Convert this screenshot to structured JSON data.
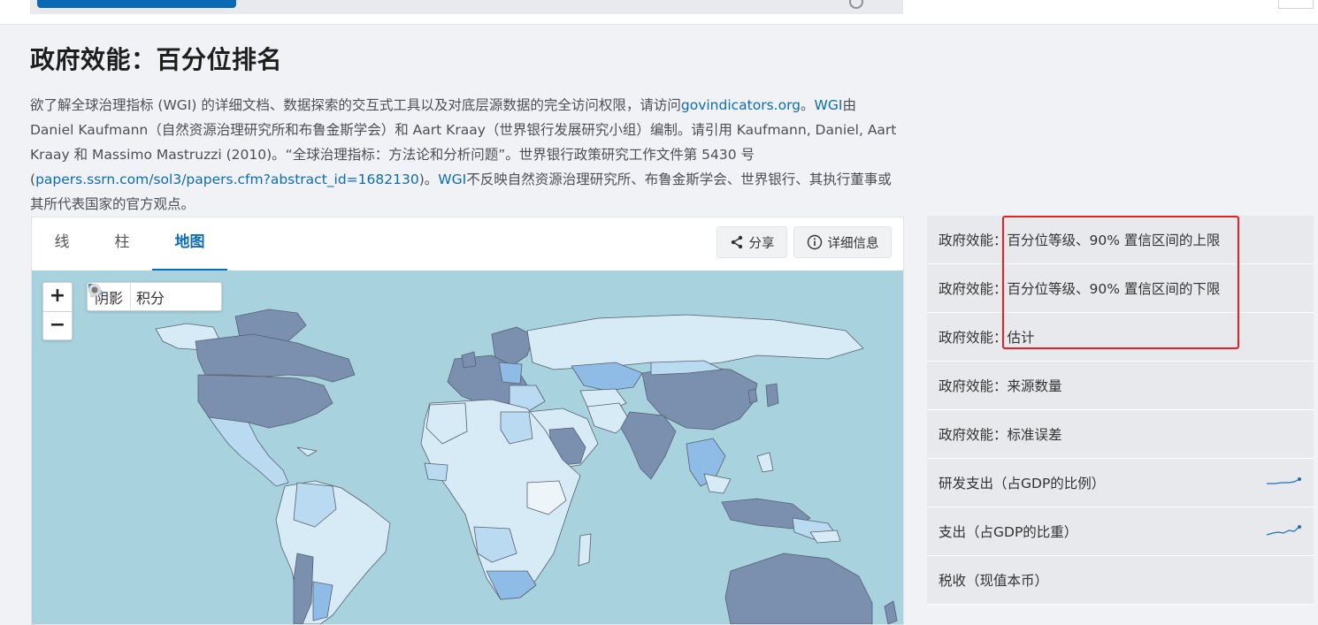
{
  "page": {
    "title": "政府效能：百分位排名",
    "description": {
      "p1": "欲了解全球治理指标 (WGI) 的详细文档、数据探索的交互式工具以及对底层源数据的完全访问权限，请访问",
      "link1": "govindicators.org",
      "p2": "。",
      "link2": "WGI",
      "p3": "由 Daniel Kaufmann（自然资源治理研究所和布鲁金斯学会）和 Aart Kraay（世界银行发展研究小组）编制。请引用 Kaufmann, Daniel, Aart Kraay 和 Massimo Mastruzzi (2010)。“全球治理指标：方法论和分析问题”。世界银行政策研究工作文件第 5430 号 (",
      "link3": "papers.ssrn.com/sol3/papers.cfm?abstract_id=1682130",
      "p4": ")。",
      "link4": "WGI",
      "p5": "不反映自然资源治理研究所、布鲁金斯学会、世界银行、其执行董事或其所代表国家的官方观点。"
    }
  },
  "chart": {
    "tabs": [
      "线",
      "柱",
      "地图"
    ],
    "active_tab": "地图",
    "share_label": "分享",
    "info_label": "详细信息",
    "zoom_in": "+",
    "zoom_out": "−",
    "mode_shade": "阴影",
    "mode_points": "积分",
    "colors": {
      "ocean": "#a7d2de",
      "highest": "#7b8faf",
      "high": "#8fbce6",
      "mid": "#b9daf0",
      "low": "#d6ebf6",
      "lowest": "#eef5fa"
    }
  },
  "related": {
    "items": [
      {
        "label": "政府效能：百分位等级、90% 置信区间的上限"
      },
      {
        "label": "政府效能：百分位等级、90% 置信区间的下限"
      },
      {
        "label": "政府效能：估计"
      },
      {
        "label": "政府效能：来源数量"
      },
      {
        "label": "政府效能：标准误差"
      },
      {
        "label": "研发支出（占GDP的比例）",
        "sparkline": true
      },
      {
        "label": "支出（占GDP的比重）",
        "sparkline": true
      },
      {
        "label": "税收（现值本币）"
      }
    ],
    "highlight_color": "#ec1e24"
  }
}
